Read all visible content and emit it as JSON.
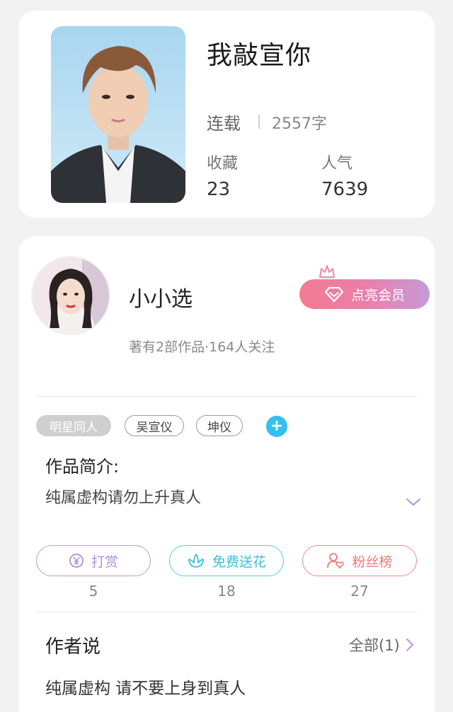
{
  "book": {
    "title": "我敲宣你",
    "status": "连载",
    "word_count": "2557字",
    "favorites_label": "收藏",
    "favorites_value": "23",
    "popularity_label": "人气",
    "popularity_value": "7639"
  },
  "author": {
    "name": "小小选",
    "meta": "著有2部作品·164人关注",
    "vip_button": "点亮会员"
  },
  "tags": [
    "明星同人",
    "吴宣仪",
    "坤仪"
  ],
  "intro": {
    "label": "作品简介:",
    "text": "纯属虚构请勿上升真人"
  },
  "actions": [
    {
      "label": "打赏",
      "count": "5",
      "icon": "yen-coin-icon"
    },
    {
      "label": "免费送花",
      "count": "18",
      "icon": "flower-icon"
    },
    {
      "label": "粉丝榜",
      "count": "27",
      "icon": "fan-heart-icon"
    }
  ],
  "author_says": {
    "label": "作者说",
    "all_link": "全部(1)",
    "text": "纯属虚构 请不要上身到真人"
  },
  "colors": {
    "vip_gradient_start": "#f37a92",
    "vip_gradient_end": "#c79ad8",
    "reward_purple": "#b18ddc",
    "flower_cyan": "#3cbfdf",
    "fans_red": "#e97b7b",
    "add_tag_blue": "#33bff0"
  }
}
